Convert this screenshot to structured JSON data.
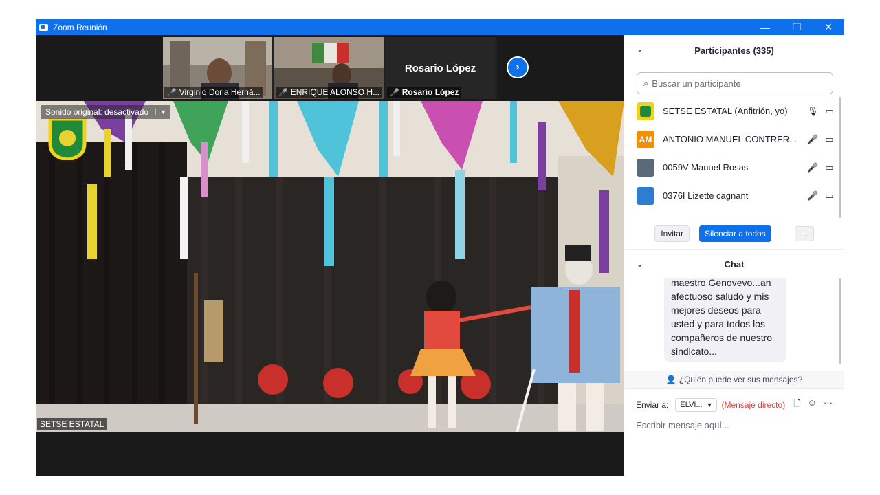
{
  "window": {
    "title": "Zoom Reunión",
    "controls": {
      "minimize": "—",
      "restore": "❐",
      "close": "✕"
    }
  },
  "video": {
    "thumbnails": [
      {
        "name": "Virginio Doria Herná..."
      },
      {
        "name": "ENRIQUE ALONSO H..."
      },
      {
        "name": "Rosario López",
        "display": "Rosario López"
      }
    ],
    "next_icon": "chevron-right-icon",
    "audio_badge": "Sonido original: desactivado",
    "active_speaker_label": "SETSE ESTATAL"
  },
  "participants": {
    "header": "Participantes (335)",
    "search_placeholder": "Buscar un participante",
    "list": [
      {
        "name": "SETSE ESTATAL (Anfitrión, yo)",
        "avatar": "",
        "avatar_color": "#f2d21b",
        "muted": false
      },
      {
        "name": "ANTONIO MANUEL CONTRER...",
        "avatar": "AM",
        "avatar_color": "#f0900a",
        "muted": true
      },
      {
        "name": "0059V Manuel Rosas",
        "avatar": "",
        "avatar_color": "#5a6a7a",
        "muted": true
      },
      {
        "name": "0376I Lizette cagnant",
        "avatar": "",
        "avatar_color": "#2d7dd2",
        "muted": true
      }
    ],
    "actions": {
      "invite": "Invitar",
      "mute_all": "Silenciar a todos",
      "more": "..."
    }
  },
  "chat": {
    "header": "Chat",
    "message": "maestro Genovevo...an afectuoso saludo y mis mejores deseos para usted y para todos los compañeros de nuestro sindicato...",
    "message_lines": [
      "maestro Genovevo...an",
      "afectuoso saludo y mis",
      "mejores deseos para",
      "usted y para todos los",
      "compañeros de nuestro",
      "sindicato..."
    ],
    "who_can_see": "¿Quién puede ver sus mensajes?",
    "send_to_label": "Enviar a:",
    "recipient": "ELVI...",
    "direct_tag": "(Mensaje directo)",
    "compose_placeholder": "Escribir mensaje aquí..."
  }
}
